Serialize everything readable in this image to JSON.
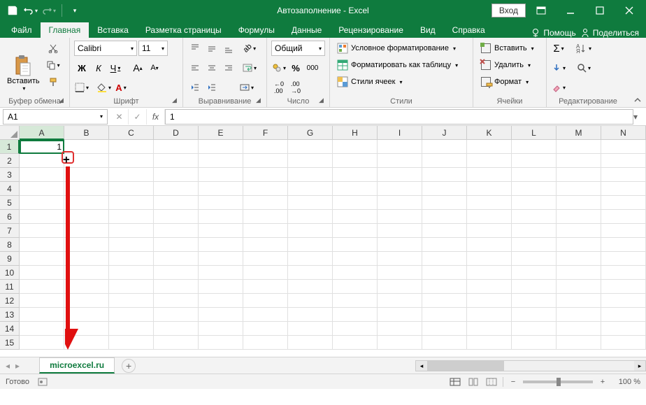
{
  "window": {
    "title": "Автозаполнение  -  Excel",
    "login": "Вход"
  },
  "tabs": {
    "file": "Файл",
    "home": "Главная",
    "insert": "Вставка",
    "page_layout": "Разметка страницы",
    "formulas": "Формулы",
    "data": "Данные",
    "review": "Рецензирование",
    "view": "Вид",
    "help": "Справка",
    "tell_me": "Помощь",
    "share": "Поделиться"
  },
  "ribbon": {
    "clipboard": {
      "label": "Буфер обмена",
      "paste": "Вставить"
    },
    "font": {
      "label": "Шрифт",
      "name": "Calibri",
      "size": "11",
      "bold": "Ж",
      "italic": "К",
      "underline": "Ч"
    },
    "alignment": {
      "label": "Выравнивание"
    },
    "number": {
      "label": "Число",
      "format": "Общий"
    },
    "styles": {
      "label": "Стили",
      "cond_format": "Условное форматирование",
      "as_table": "Форматировать как таблицу",
      "cell_styles": "Стили ячеек"
    },
    "cells": {
      "label": "Ячейки",
      "insert": "Вставить",
      "delete": "Удалить",
      "format": "Формат"
    },
    "editing": {
      "label": "Редактирование"
    }
  },
  "formula_bar": {
    "name_box": "A1",
    "fx": "fx",
    "value": "1"
  },
  "grid": {
    "columns": [
      "A",
      "B",
      "C",
      "D",
      "E",
      "F",
      "G",
      "H",
      "I",
      "J",
      "K",
      "L",
      "M",
      "N"
    ],
    "rows": [
      "1",
      "2",
      "3",
      "4",
      "5",
      "6",
      "7",
      "8",
      "9",
      "10",
      "11",
      "12",
      "13",
      "14",
      "15"
    ],
    "active_cell_value": "1"
  },
  "sheet": {
    "name": "microexcel.ru"
  },
  "status": {
    "ready": "Готово",
    "zoom": "100 %"
  }
}
